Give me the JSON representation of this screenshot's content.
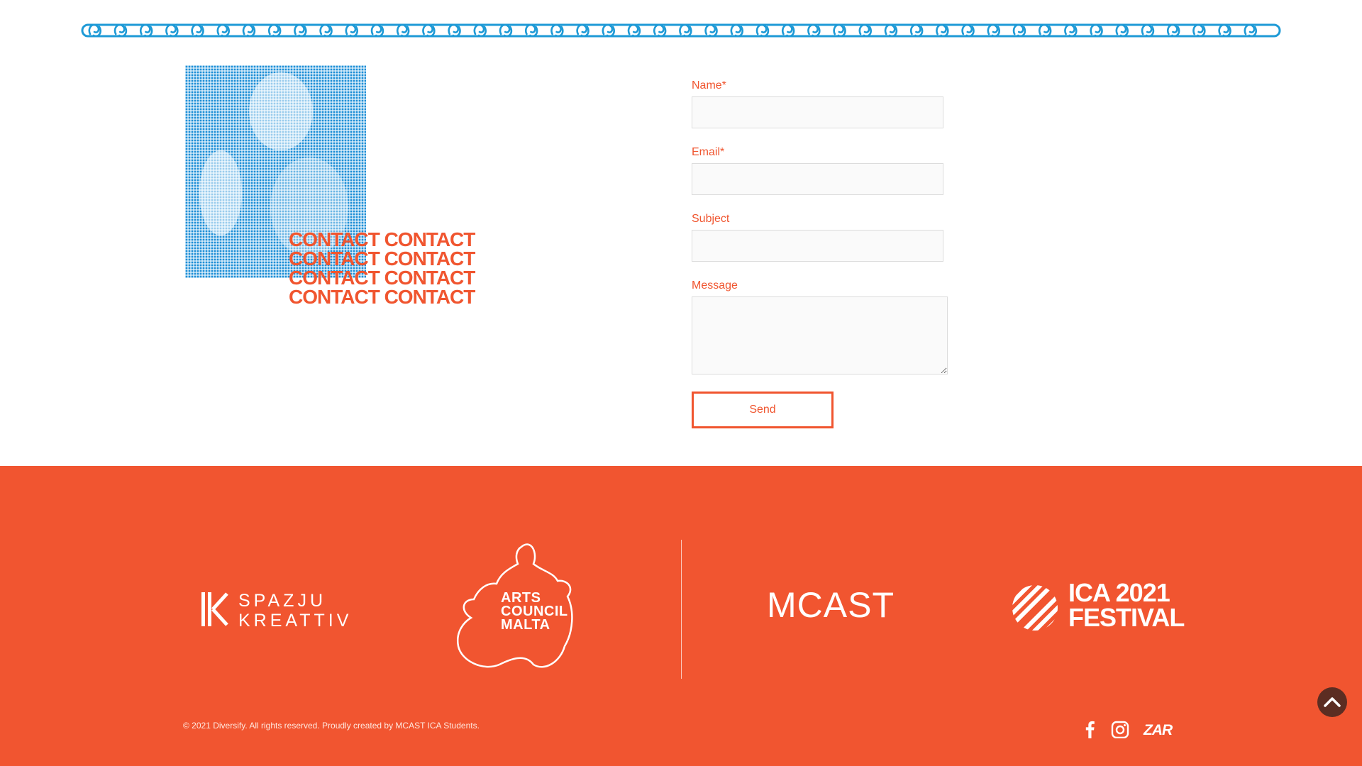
{
  "hero": {
    "title_lines": [
      "CONTACT CONTACT",
      "CONTACT CONTACT",
      "CONTACT CONTACT",
      "CONTACT CONTACT"
    ]
  },
  "form": {
    "name_label": "Name*",
    "name_value": "",
    "email_label": "Email*",
    "email_value": "",
    "subject_label": "Subject",
    "subject_value": "",
    "message_label": "Message",
    "message_value": "",
    "send_label": "Send"
  },
  "footer": {
    "partners": {
      "spazju_line1": "SPAZJU",
      "spazju_line2": "KREATTIV",
      "arts_line1": "ARTS",
      "arts_line2": "COUNCIL",
      "arts_line3": "MALTA",
      "mcast": "MCAST",
      "ica_line1": "ICA 2021",
      "ica_line2": "FESTIVAL"
    },
    "copyright": "© 2021 Diversify. All rights reserved. Proudly created by MCAST ICA Students.",
    "social": {
      "facebook_icon": "facebook-icon",
      "instagram_icon": "instagram-icon",
      "zar_logo": "ZAR"
    }
  },
  "colors": {
    "accent": "#f0552f",
    "footer_bg": "#f15530",
    "chain_blue": "#1e9ad6",
    "back_to_top": "#5c2d22"
  },
  "icons": {
    "back_to_top": "chevron-up-icon"
  }
}
